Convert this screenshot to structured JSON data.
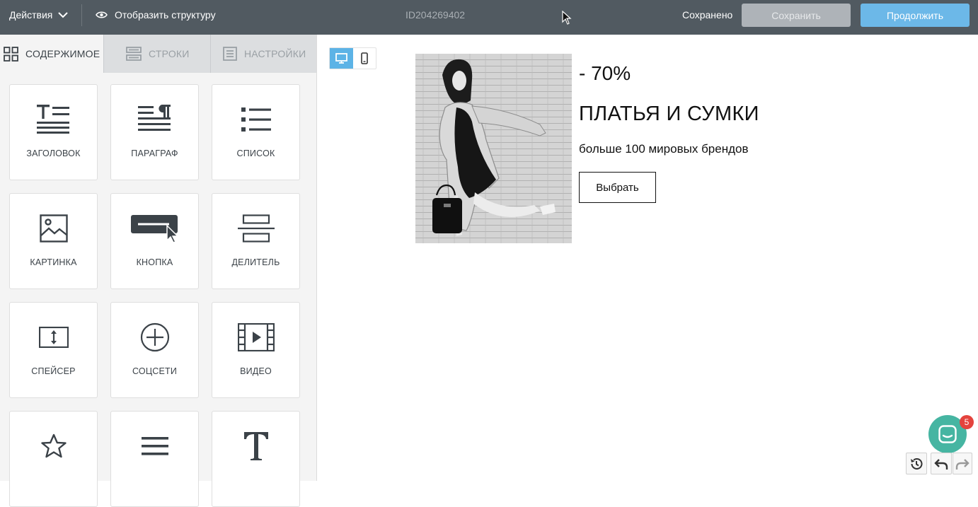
{
  "topbar": {
    "actions_label": "Действия",
    "structure_label": "Отобразить структуру",
    "document_id": "ID204269402",
    "status": "Сохранено",
    "save_label": "Сохранить",
    "continue_label": "Продолжить"
  },
  "panel": {
    "tabs": [
      {
        "label": "СОДЕРЖИМОЕ",
        "icon": "grid-icon",
        "active": true
      },
      {
        "label": "СТРОКИ",
        "icon": "rows-icon",
        "active": false
      },
      {
        "label": "НАСТРОЙКИ",
        "icon": "settings-doc-icon",
        "active": false
      }
    ],
    "blocks": [
      {
        "label": "ЗАГОЛОВОК",
        "icon": "heading-icon"
      },
      {
        "label": "ПАРАГРАФ",
        "icon": "paragraph-icon"
      },
      {
        "label": "СПИСОК",
        "icon": "list-icon"
      },
      {
        "label": "КАРТИНКА",
        "icon": "image-icon"
      },
      {
        "label": "КНОПКА",
        "icon": "button-icon"
      },
      {
        "label": "ДЕЛИТЕЛЬ",
        "icon": "divider-icon"
      },
      {
        "label": "СПЕЙСЕР",
        "icon": "spacer-icon"
      },
      {
        "label": "СОЦСЕТИ",
        "icon": "social-icon"
      },
      {
        "label": "ВИДЕО",
        "icon": "video-icon"
      },
      {
        "label": "",
        "icon": "star-icon"
      },
      {
        "label": "",
        "icon": "menu-icon"
      },
      {
        "label": "",
        "icon": "text-icon"
      }
    ]
  },
  "canvas": {
    "view_modes": [
      "desktop",
      "mobile"
    ],
    "active_view": "desktop",
    "promo": {
      "discount": "- 70%",
      "title": "ПЛАТЬЯ И СУМКИ",
      "subtitle": "больше 100 мировых брендов",
      "button_label": "Выбрать"
    }
  },
  "chat": {
    "unread_count": "5"
  },
  "colors": {
    "topbar_bg": "#515a61",
    "save_button_bg": "#aeb3b8",
    "continue_button_bg": "#6cb8e8",
    "active_view_bg": "#5cb3e6",
    "chat_bg": "#46b5a2",
    "badge_bg": "#e4433d"
  }
}
